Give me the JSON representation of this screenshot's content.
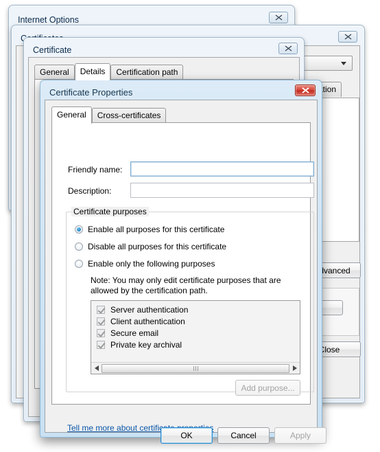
{
  "windows": {
    "internet_options": {
      "title": "Internet Options",
      "close_icon": "close-icon"
    },
    "certificates": {
      "title": "Certificates",
      "close_icon": "close-icon",
      "close_button_label": "Close"
    },
    "certificate": {
      "title": "Certificate",
      "close_icon": "close-icon",
      "tabs": [
        {
          "label": "General",
          "active": false
        },
        {
          "label": "Details",
          "active": true
        },
        {
          "label": "Certification path",
          "active": false
        }
      ],
      "advanced_button_label": "Advanced",
      "partial_tab_label": "fication"
    }
  },
  "dialog": {
    "title": "Certificate Properties",
    "close_icon": "close-icon",
    "tabs": [
      {
        "label": "General",
        "active": true
      },
      {
        "label": "Cross-certificates",
        "active": false
      }
    ],
    "fields": [
      {
        "label": "Friendly name:",
        "value": "",
        "placeholder": "",
        "focused": true
      },
      {
        "label": "Description:",
        "value": "",
        "placeholder": "",
        "focused": false
      }
    ],
    "group": {
      "title": "Certificate purposes",
      "radios": [
        {
          "label": "Enable all purposes for this certificate",
          "selected": true
        },
        {
          "label": "Disable all purposes for this certificate",
          "selected": false
        },
        {
          "label": "Enable only the following purposes",
          "selected": false
        }
      ],
      "note": "Note: You may only edit certificate purposes that are allowed by the certification path.",
      "purposes": [
        {
          "label": "Server authentication",
          "checked": true,
          "enabled": false
        },
        {
          "label": "Client authentication",
          "checked": true,
          "enabled": false
        },
        {
          "label": "Secure email",
          "checked": true,
          "enabled": false
        },
        {
          "label": "Private key archival",
          "checked": true,
          "enabled": false
        }
      ],
      "add_purpose_label": "Add purpose...",
      "add_purpose_disabled": true
    },
    "help_link": "Tell me more about certificate properties",
    "buttons": [
      {
        "label": "OK",
        "state": "default"
      },
      {
        "label": "Cancel",
        "state": "normal"
      },
      {
        "label": "Apply",
        "state": "disabled"
      }
    ]
  },
  "colors": {
    "accent": "#2e8ccf",
    "link": "#0a56a8",
    "close_red": "#c02d22",
    "dialog_face": "#f0f0f0"
  }
}
